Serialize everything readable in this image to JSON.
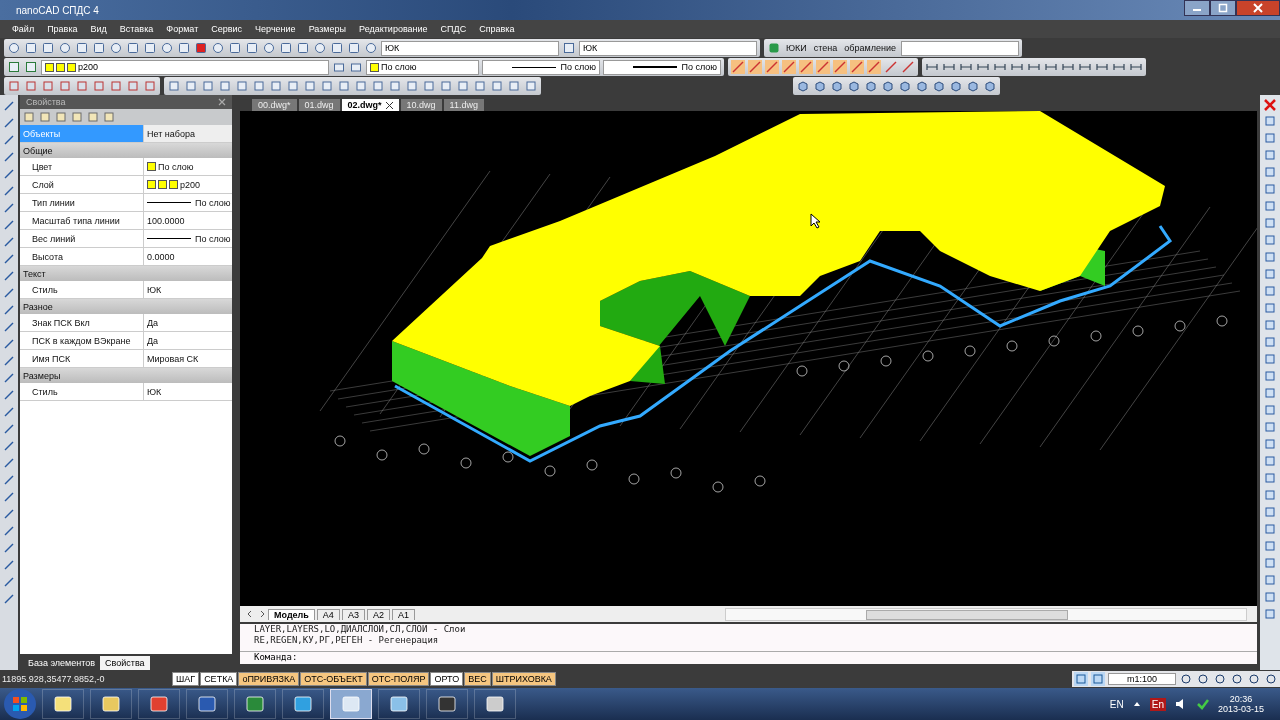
{
  "window": {
    "title": "nanoCAD СПДС 4"
  },
  "menu": [
    "Файл",
    "Правка",
    "Вид",
    "Вставка",
    "Формат",
    "Сервис",
    "Черчение",
    "Размеры",
    "Редактирование",
    "СПДС",
    "Справка"
  ],
  "toolbar": {
    "text_style": "ЮК",
    "dim_style": "ЮК",
    "spds_items": [
      "ЮКИ",
      "стена",
      "обрамление"
    ],
    "layer": "p200",
    "color_value": "По слою",
    "linetype": "По слою",
    "lineweight": "По слою"
  },
  "doc_tabs": [
    {
      "label": "00.dwg*",
      "selected": false
    },
    {
      "label": "01.dwg",
      "selected": false
    },
    {
      "label": "02.dwg*",
      "selected": true
    },
    {
      "label": "10.dwg",
      "selected": false
    },
    {
      "label": "11.dwg",
      "selected": false
    }
  ],
  "properties": {
    "title": "Свойства",
    "selection_label": "Объекты",
    "selection_value": "Нет набора",
    "groups": [
      {
        "name": "Общие",
        "rows": [
          {
            "label": "Цвет",
            "value": "По слою",
            "kind": "color"
          },
          {
            "label": "Слой",
            "value": "p200",
            "kind": "layer"
          },
          {
            "label": "Тип линии",
            "value": "По слою",
            "kind": "line"
          },
          {
            "label": "Масштаб типа линии",
            "value": "100.0000",
            "kind": "text"
          },
          {
            "label": "Вес линий",
            "value": "По слою",
            "kind": "line"
          },
          {
            "label": "Высота",
            "value": "0.0000",
            "kind": "text"
          }
        ]
      },
      {
        "name": "Текст",
        "rows": [
          {
            "label": "Стиль",
            "value": "ЮК",
            "kind": "text"
          }
        ]
      },
      {
        "name": "Разное",
        "rows": [
          {
            "label": "Знак ПСК Вкл",
            "value": "Да",
            "kind": "text"
          },
          {
            "label": "ПСК в каждом ВЭкране",
            "value": "Да",
            "kind": "text"
          },
          {
            "label": "Имя ПСК",
            "value": "Мировая СК",
            "kind": "text"
          }
        ]
      },
      {
        "name": "Размеры",
        "rows": [
          {
            "label": "Стиль",
            "value": "ЮК",
            "kind": "text"
          }
        ]
      }
    ]
  },
  "panel_tabs": [
    {
      "label": "База элементов",
      "selected": false
    },
    {
      "label": "Свойства",
      "selected": true
    }
  ],
  "layout_tabs": [
    {
      "label": "Модель",
      "selected": true
    },
    {
      "label": "A4",
      "selected": false
    },
    {
      "label": "A3",
      "selected": false
    },
    {
      "label": "A2",
      "selected": false
    },
    {
      "label": "A1",
      "selected": false
    }
  ],
  "command": {
    "history": [
      "LAYER,LAYERS,LO,ДИАЛСЛОИ,СЛ,СЛОИ - Слои",
      "RE,REGEN,КУ,РГ,РЕГЕН - Регенерация"
    ],
    "prompt": "Команда:"
  },
  "coordinates": "11895.928,35477.9852,-0",
  "status_buttons": [
    {
      "label": "ШАГ",
      "on": false
    },
    {
      "label": "СЕТКА",
      "on": false
    },
    {
      "label": "оПРИВЯЗКА",
      "on": true
    },
    {
      "label": "ОТС-ОБЪЕКТ",
      "on": true
    },
    {
      "label": "ОТС-ПОЛЯР",
      "on": true
    },
    {
      "label": "ОРТО",
      "on": false
    },
    {
      "label": "ВЕС",
      "on": true
    },
    {
      "label": "ШТРИХОВКА",
      "on": true
    }
  ],
  "scale": "m1:100",
  "taskbar": {
    "apps": [
      {
        "selected": false
      },
      {
        "selected": false
      },
      {
        "selected": false
      },
      {
        "selected": false
      },
      {
        "selected": false
      },
      {
        "selected": false
      },
      {
        "selected": true
      },
      {
        "selected": false
      },
      {
        "selected": false
      },
      {
        "selected": false
      }
    ],
    "language": "EN",
    "input_indicator": "En",
    "time": "20:36",
    "date": "2013-03-15"
  }
}
